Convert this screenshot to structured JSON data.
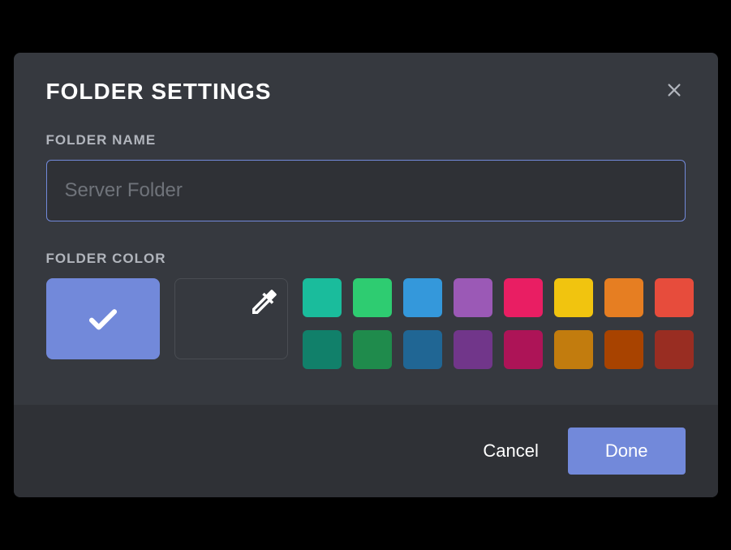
{
  "modal": {
    "title": "FOLDER SETTINGS",
    "name_section_label": "FOLDER NAME",
    "name_input_value": "",
    "name_input_placeholder": "Server Folder",
    "color_section_label": "FOLDER COLOR",
    "selected_color": "#7289da",
    "palette": [
      "#1abc9c",
      "#2ecc71",
      "#3498db",
      "#9b59b6",
      "#e91e63",
      "#f1c40f",
      "#e67e22",
      "#e74c3c",
      "#11806a",
      "#1f8b4c",
      "#206694",
      "#71368a",
      "#ad1457",
      "#c27c0e",
      "#a84300",
      "#992d22"
    ],
    "cancel_label": "Cancel",
    "done_label": "Done"
  }
}
